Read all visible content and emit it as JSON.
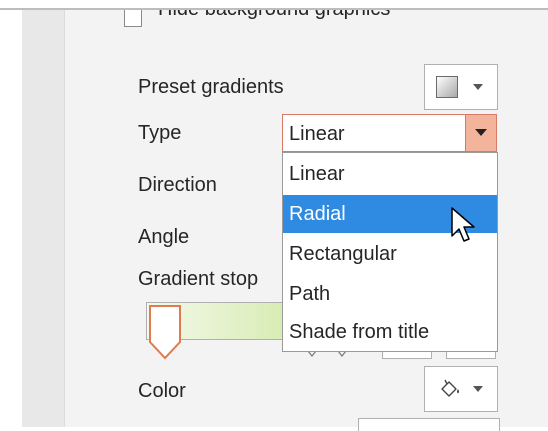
{
  "panel": {
    "hide_background_label": "Hide background graphics",
    "preset_gradients_label": "Preset gradients",
    "type_label": "Type",
    "direction_label": "Direction",
    "angle_label": "Angle",
    "gradient_stops_label": "Gradient stop",
    "color_label": "Color"
  },
  "type_select": {
    "value": "Linear",
    "options": [
      "Linear",
      "Radial",
      "Rectangular",
      "Path",
      "Shade from title"
    ],
    "highlighted": "Radial"
  },
  "icons": {
    "preset": "gradient-preset-icon",
    "color": "paint-bucket-icon",
    "cursor": "mouse-pointer-icon"
  },
  "colors": {
    "highlight": "#2f8be2",
    "select_border": "#d77b66",
    "select_arrow_bg": "#f4b49c",
    "stop_marker": "#e07a4f"
  }
}
